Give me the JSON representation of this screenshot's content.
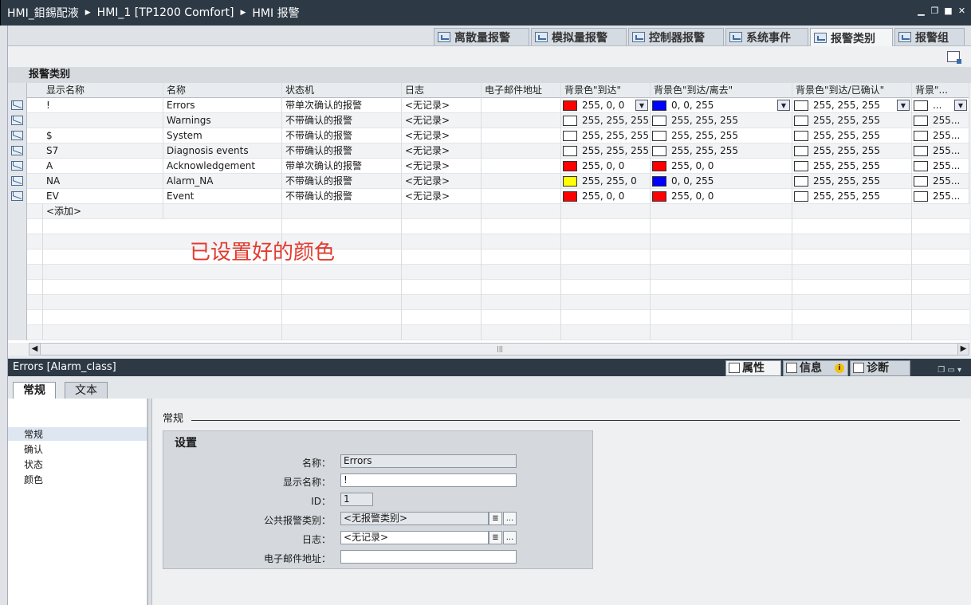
{
  "breadcrumb": {
    "items": [
      "HMI_鉬錫配液",
      "HMI_1 [TP1200 Comfort]",
      "HMI 报警"
    ]
  },
  "window_controls": [
    "minimize",
    "restore",
    "maximize",
    "close"
  ],
  "editor_tabs": [
    {
      "label": "离散量报警",
      "active": false
    },
    {
      "label": "模拟量报警",
      "active": false
    },
    {
      "label": "控制器报警",
      "active": false
    },
    {
      "label": "系统事件",
      "active": false
    },
    {
      "label": "报警类别",
      "active": true
    },
    {
      "label": "报警组",
      "active": false
    }
  ],
  "section_title": "报警类别",
  "grid": {
    "columns": [
      "显示名称",
      "名称",
      "状态机",
      "日志",
      "电子邮件地址",
      "背景色\"到达\"",
      "背景色\"到达/离去\"",
      "背景色\"到达/已确认\"",
      "背景\"..."
    ],
    "rows": [
      {
        "display": "!",
        "name": "Errors",
        "state": "带单次确认的报警",
        "log": "<无记录>",
        "email": "",
        "c1": {
          "text": "255, 0, 0",
          "color": "#ff0000"
        },
        "c2": {
          "text": "0, 0, 255",
          "color": "#0000ff"
        },
        "c3": {
          "text": "255, 255, 255",
          "color": "#ffffff"
        },
        "c4": "..."
      },
      {
        "display": "",
        "name": "Warnings",
        "state": "不带确认的报警",
        "log": "<无记录>",
        "email": "",
        "c1": {
          "text": "255, 255, 255",
          "color": "#ffffff"
        },
        "c2": {
          "text": "255, 255, 255",
          "color": "#ffffff"
        },
        "c3": {
          "text": "255, 255, 255",
          "color": "#ffffff"
        },
        "c4": "255..."
      },
      {
        "display": "$",
        "name": "System",
        "state": "不带确认的报警",
        "log": "<无记录>",
        "email": "",
        "c1": {
          "text": "255, 255, 255",
          "color": "#ffffff"
        },
        "c2": {
          "text": "255, 255, 255",
          "color": "#ffffff"
        },
        "c3": {
          "text": "255, 255, 255",
          "color": "#ffffff"
        },
        "c4": "255..."
      },
      {
        "display": "S7",
        "name": "Diagnosis events",
        "state": "不带确认的报警",
        "log": "<无记录>",
        "email": "",
        "c1": {
          "text": "255, 255, 255",
          "color": "#ffffff"
        },
        "c2": {
          "text": "255, 255, 255",
          "color": "#ffffff"
        },
        "c3": {
          "text": "255, 255, 255",
          "color": "#ffffff"
        },
        "c4": "255..."
      },
      {
        "display": "A",
        "name": "Acknowledgement",
        "state": "带单次确认的报警",
        "log": "<无记录>",
        "email": "",
        "c1": {
          "text": "255, 0, 0",
          "color": "#ff0000"
        },
        "c2": {
          "text": "255, 0, 0",
          "color": "#ff0000"
        },
        "c3": {
          "text": "255, 255, 255",
          "color": "#ffffff"
        },
        "c4": "255..."
      },
      {
        "display": "NA",
        "name": "Alarm_NA",
        "state": "不带确认的报警",
        "log": "<无记录>",
        "email": "",
        "c1": {
          "text": "255, 255, 0",
          "color": "#ffff00"
        },
        "c2": {
          "text": "0, 0, 255",
          "color": "#0000ff"
        },
        "c3": {
          "text": "255, 255, 255",
          "color": "#ffffff"
        },
        "c4": "255..."
      },
      {
        "display": "EV",
        "name": "Event",
        "state": "不带确认的报警",
        "log": "<无记录>",
        "email": "",
        "c1": {
          "text": "255, 0, 0",
          "color": "#ff0000"
        },
        "c2": {
          "text": "255, 0, 0",
          "color": "#ff0000"
        },
        "c3": {
          "text": "255, 255, 255",
          "color": "#ffffff"
        },
        "c4": "255..."
      }
    ],
    "add_label": "<添加>"
  },
  "annotation": "已设置好的颜色",
  "properties": {
    "object_title": "Errors [Alarm_class]",
    "tabs": [
      "属性",
      "信息",
      "诊断"
    ],
    "subtabs": [
      "常规",
      "文本"
    ],
    "nav": [
      "常规",
      "确认",
      "状态",
      "颜色"
    ],
    "section": "常规",
    "group_title": "设置",
    "fields": [
      {
        "label": "名称：",
        "value": "Errors"
      },
      {
        "label": "显示名称：",
        "value": "!"
      },
      {
        "label": "ID：",
        "value": "1"
      },
      {
        "label": "公共报警类别：",
        "value": "<无报警类别>"
      },
      {
        "label": "日志：",
        "value": "<无记录>"
      },
      {
        "label": "电子邮件地址：",
        "value": ""
      }
    ]
  }
}
